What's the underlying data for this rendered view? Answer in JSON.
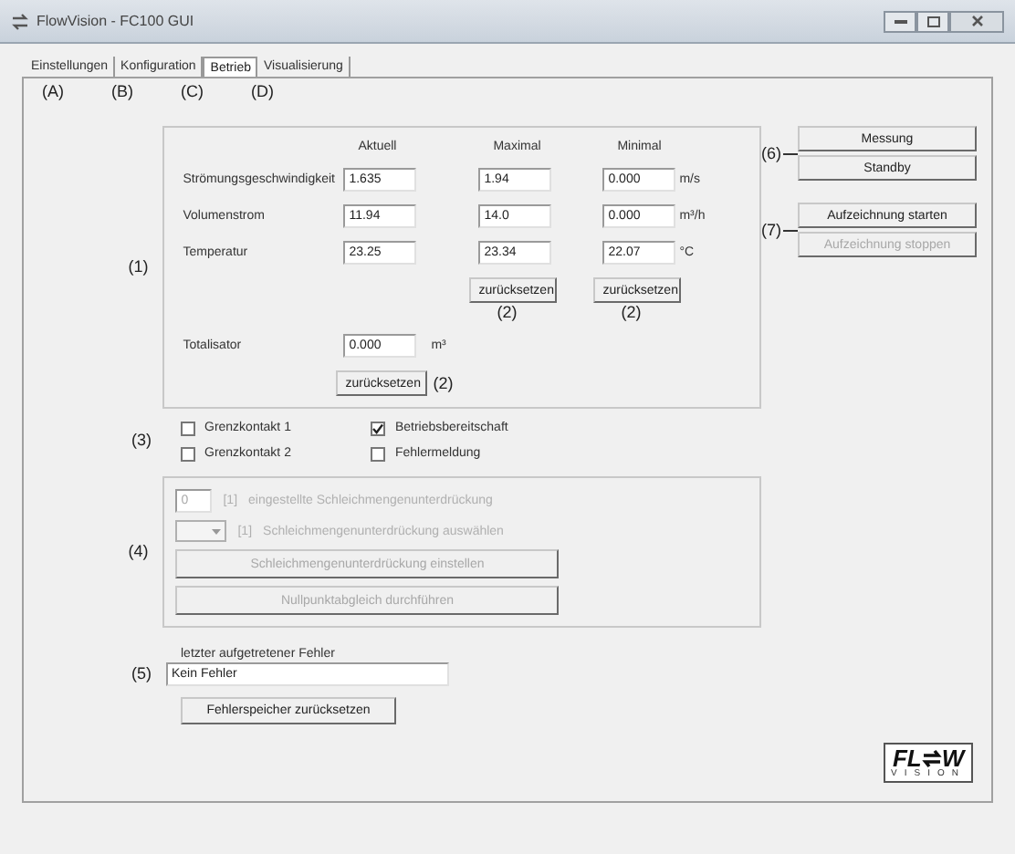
{
  "window": {
    "title": "FlowVision - FC100 GUI"
  },
  "tabs": [
    {
      "label": "Einstellungen",
      "selected": false,
      "annotation": "(A)"
    },
    {
      "label": "Konfiguration",
      "selected": false,
      "annotation": "(B)"
    },
    {
      "label": "Betrieb",
      "selected": true,
      "annotation": "(C)"
    },
    {
      "label": "Visualisierung",
      "selected": false,
      "annotation": "(D)"
    }
  ],
  "measurements": {
    "annotation": "(1)",
    "columns": [
      "Aktuell",
      "Maximal",
      "Minimal"
    ],
    "rows": [
      {
        "label": "Strömungsgeschwindigkeit",
        "values": [
          "1.635",
          "1.94",
          "0.000"
        ],
        "unit": "m/s"
      },
      {
        "label": "Volumenstrom",
        "values": [
          "11.94",
          "14.0",
          "0.000"
        ],
        "unit": "m³/h"
      },
      {
        "label": "Temperatur",
        "values": [
          "23.25",
          "23.34",
          "22.07"
        ],
        "unit": "°C"
      }
    ],
    "reset_buttons": [
      {
        "label": "zurücksetzen",
        "annotation": "(2)"
      },
      {
        "label": "zurücksetzen",
        "annotation": "(2)"
      }
    ],
    "totalizer": {
      "label": "Totalisator",
      "value": "0.000",
      "unit": "m³",
      "reset": "zurücksetzen",
      "annotation": "(2)"
    }
  },
  "contacts": {
    "annotation": "(3)",
    "items": [
      {
        "label": "Grenzkontakt 1",
        "checked": false
      },
      {
        "label": "Grenzkontakt 2",
        "checked": false
      },
      {
        "label": "Betriebsbereitschaft",
        "checked": true
      },
      {
        "label": "Fehlermeldung",
        "checked": false
      }
    ]
  },
  "low_flow": {
    "annotation": "(4)",
    "disabled": true,
    "value": "0",
    "value_unit": "[1]",
    "value_label": "eingestellte Schleichmengenunterdrückung",
    "select_unit": "[1]",
    "select_label": "Schleichmengenunterdrückung auswählen",
    "buttons": [
      "Schleichmengenunterdrückung einstellen",
      "Nullpunktabgleich durchführen"
    ]
  },
  "error": {
    "annotation": "(5)",
    "label": "letzter aufgetretener Fehler",
    "value": "Kein Fehler",
    "button": "Fehlerspeicher zurücksetzen"
  },
  "mode": {
    "annotation": "(6)",
    "buttons": [
      {
        "label": "Messung",
        "disabled": false
      },
      {
        "label": "Standby",
        "disabled": false
      }
    ]
  },
  "recording": {
    "annotation": "(7)",
    "buttons": [
      {
        "label": "Aufzeichnung starten",
        "disabled": false
      },
      {
        "label": "Aufzeichnung stoppen",
        "disabled": true
      }
    ]
  },
  "logo": {
    "left": "FL",
    "right": "W",
    "sub": "VISION"
  }
}
